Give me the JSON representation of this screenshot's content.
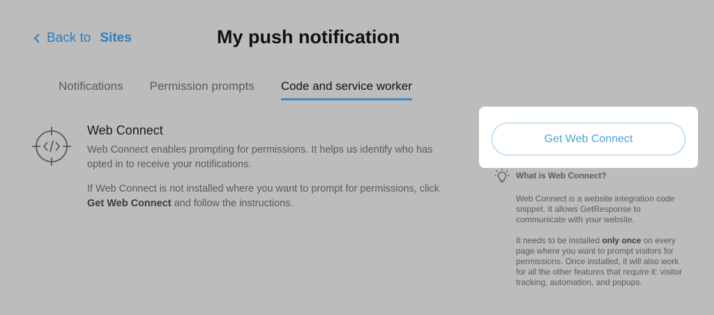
{
  "header": {
    "back_prefix": "Back to",
    "back_target": "Sites",
    "title": "My push notification"
  },
  "tabs": [
    {
      "label": "Notifications",
      "active": false
    },
    {
      "label": "Permission prompts",
      "active": false
    },
    {
      "label": "Code and service worker",
      "active": true
    }
  ],
  "web_connect": {
    "icon": "code-target-icon",
    "title": "Web Connect",
    "description": "Web Connect enables prompting for permissions. It helps us identify who has opted in to receive your notifications.",
    "instructions_prefix": "If Web Connect is not installed where you want to prompt for permissions, click",
    "instructions_bold": "Get Web Connect",
    "instructions_suffix": "and follow the instructions."
  },
  "cta": {
    "button_label": "Get Web Connect"
  },
  "help": {
    "icon": "lightbulb-icon",
    "title": "What is Web Connect?",
    "p1": "Web Connect is a website integration code snippet. It allows GetResponse to communicate with your website.",
    "p2_prefix": "It needs to be installed",
    "p2_bold": "only once",
    "p2_suffix": "on every page where you want to prompt visitors for permissions. Once installed, it will also work for all the other features that require it: visitor tracking, automation, and popups."
  },
  "colors": {
    "accent": "#3b86c4",
    "link": "#2f7fbf",
    "button_text": "#4ea3d9",
    "overlay_bg": "#bcbcbc"
  }
}
